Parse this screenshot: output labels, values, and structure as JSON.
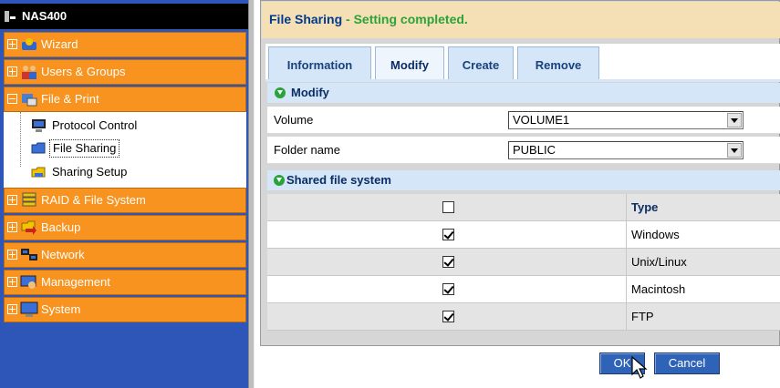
{
  "nav": {
    "title": "NAS400",
    "items": [
      {
        "label": "Wizard",
        "icon": "wizard-icon",
        "expanded": false
      },
      {
        "label": "Users & Groups",
        "icon": "users-groups-icon",
        "expanded": false
      },
      {
        "label": "File & Print",
        "icon": "file-print-icon",
        "expanded": true
      },
      {
        "label": "RAID & File System",
        "icon": "raid-icon",
        "expanded": false
      },
      {
        "label": "Backup",
        "icon": "backup-icon",
        "expanded": false
      },
      {
        "label": "Network",
        "icon": "network-icon",
        "expanded": false
      },
      {
        "label": "Management",
        "icon": "management-icon",
        "expanded": false
      },
      {
        "label": "System",
        "icon": "system-icon",
        "expanded": false
      }
    ],
    "subitems": [
      {
        "label": "Protocol Control",
        "icon": "protocol-control-icon"
      },
      {
        "label": "File Sharing",
        "icon": "folder-icon",
        "selected": true
      },
      {
        "label": "Sharing Setup",
        "icon": "sharing-setup-icon"
      }
    ]
  },
  "header": {
    "title": "File Sharing",
    "separator": " - ",
    "status": "Setting completed."
  },
  "tabs": [
    {
      "label": "Information",
      "active": false
    },
    {
      "label": "Modify",
      "active": true
    },
    {
      "label": "Create",
      "active": false
    },
    {
      "label": "Remove",
      "active": false
    }
  ],
  "modify_section": {
    "title": "Modify",
    "volume": {
      "label": "Volume",
      "value": "VOLUME1"
    },
    "folder": {
      "label": "Folder name",
      "value": "PUBLIC"
    }
  },
  "shared_section": {
    "title": "Shared file system",
    "type_header": "Type",
    "rows": [
      {
        "type": "Windows",
        "checked": true
      },
      {
        "type": "Unix/Linux",
        "checked": true
      },
      {
        "type": "Macintosh",
        "checked": true
      },
      {
        "type": "FTP",
        "checked": true
      }
    ],
    "select_all_checked": false
  },
  "buttons": {
    "ok": "OK",
    "cancel": "Cancel"
  },
  "colors": {
    "nav_orange": "#f7931e",
    "nav_blue": "#2e55b8",
    "header_bg": "#f5dfb4",
    "status_green": "#2aa33a",
    "tab_blue": "#d4e6f8"
  }
}
